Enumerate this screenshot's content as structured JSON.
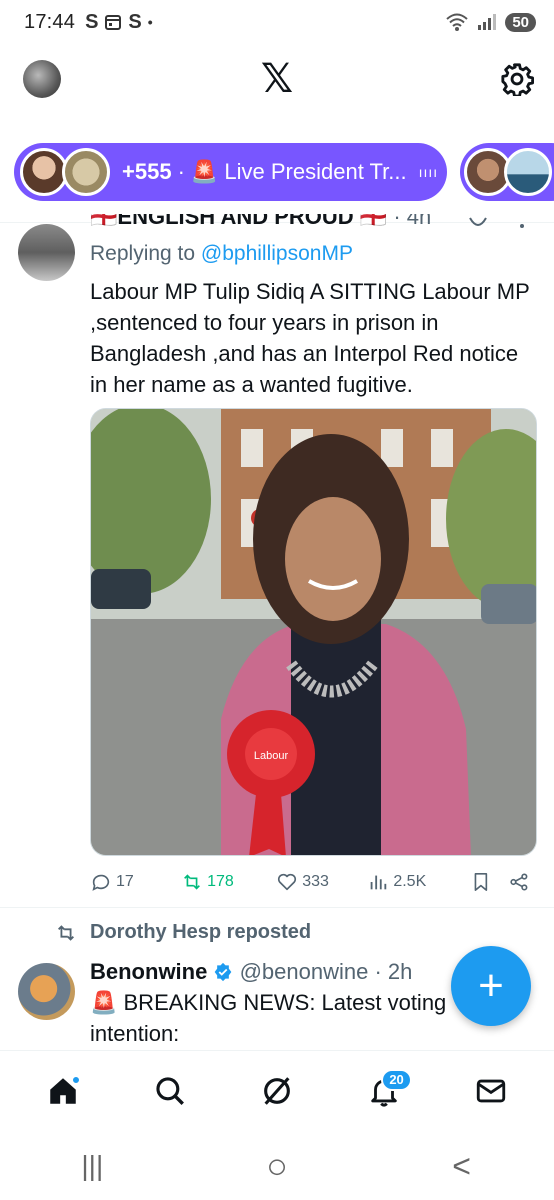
{
  "status_bar": {
    "time": "17:44",
    "notif_icons": [
      "S",
      "calendar-icon",
      "S",
      "•"
    ],
    "battery": "50"
  },
  "header": {
    "logo": "𝕏"
  },
  "spaces": {
    "count": "+555",
    "dot": "·",
    "title": "🚨 Live President Tr...",
    "bars": "ıııı"
  },
  "tweet1": {
    "name": "🏴󠁧󠁢󠁥󠁮󠁧󠁿ENGLISH AND PROUD 🏴󠁧󠁢󠁥󠁮󠁧󠁿",
    "time": "· 4h",
    "replying_prefix": "Replying to ",
    "replying_handle": "@bphillipsonMP",
    "text": "Labour MP Tulip Sidiq A SITTING Labour MP  ,sentenced to four years in prison in Bangladesh ,and has an Interpol Red notice in her name as a wanted fugitive.",
    "rosette_text": "Labour",
    "replies": "17",
    "reposts": "178",
    "likes": "333",
    "views": "2.5K"
  },
  "repost_line": "Dorothy Hesp reposted",
  "tweet2": {
    "name": "Benonwine",
    "handle": "@benonwine",
    "time": "· 2h",
    "text": "🚨 BREAKING NEWS: Latest voting intention:"
  },
  "fab": {
    "label": "+"
  },
  "bottom_nav": {
    "notifications_count": "20"
  },
  "system_nav": {
    "recents": "|||",
    "home": "○",
    "back": "<"
  },
  "colors": {
    "accent": "#1d9bf0",
    "spaces": "#7856ff",
    "repost": "#00ba7c",
    "muted": "#536471"
  }
}
